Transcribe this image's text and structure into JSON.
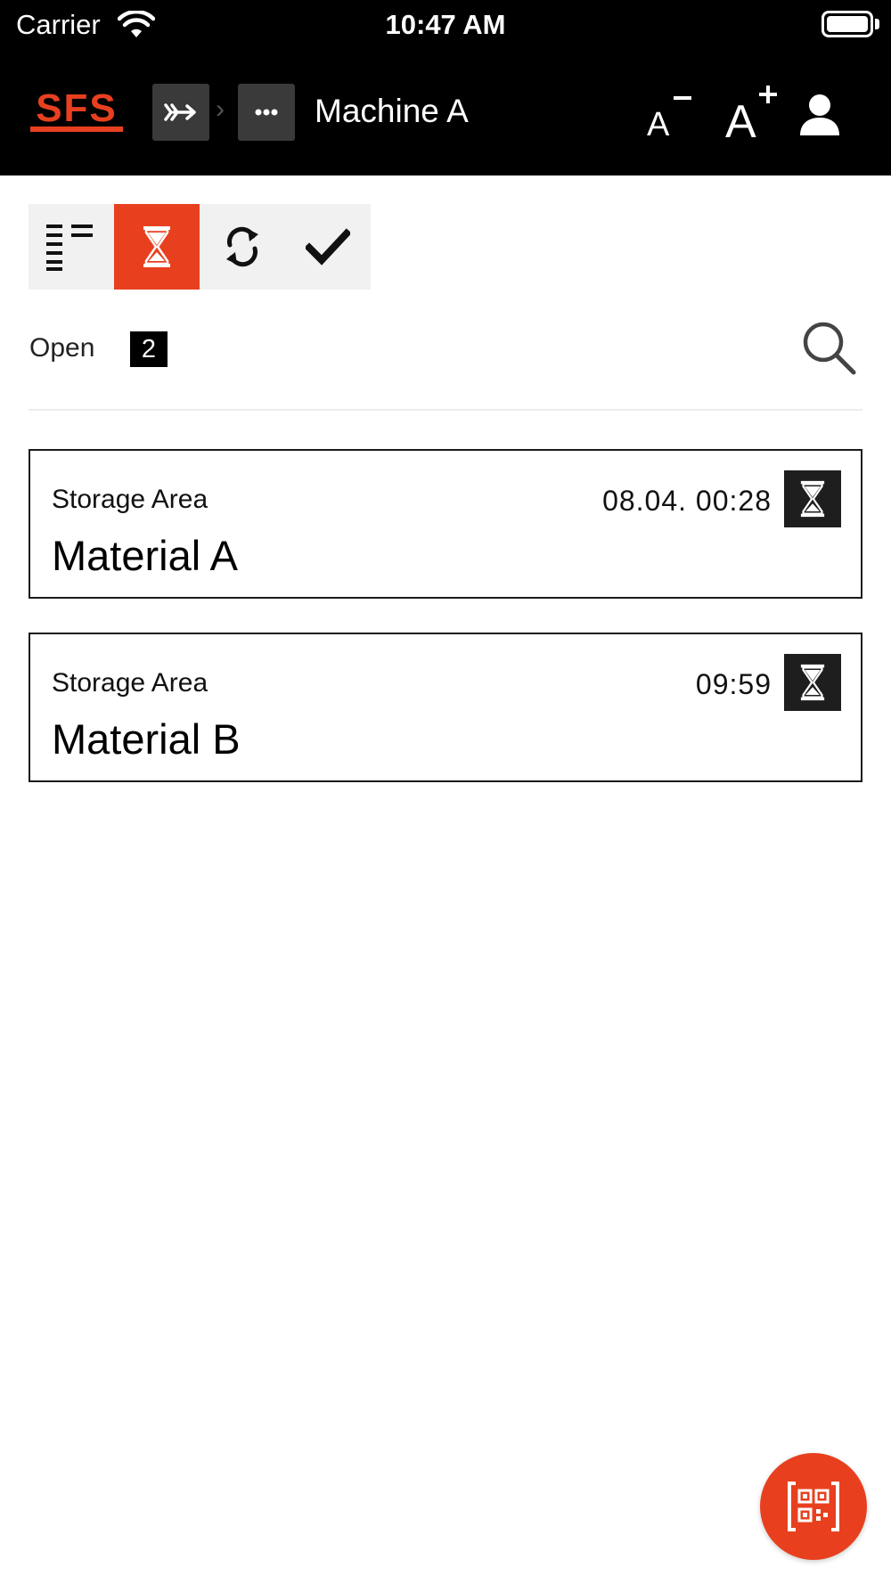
{
  "status_bar": {
    "carrier": "Carrier",
    "time": "10:47 AM"
  },
  "header": {
    "logo_text": "SFS",
    "title": "Machine A",
    "breadcrumb": [
      {
        "icon": "double-arrow-icon"
      },
      {
        "icon": "more-horizontal-icon"
      }
    ],
    "font_decrease_label": "A",
    "font_increase_label": "A"
  },
  "filters": {
    "selected": "pending",
    "items": [
      {
        "id": "all",
        "icon": "list-icon"
      },
      {
        "id": "pending",
        "icon": "hourglass-icon"
      },
      {
        "id": "in-progress",
        "icon": "refresh-icon"
      },
      {
        "id": "done",
        "icon": "checkmark-icon"
      }
    ]
  },
  "summary": {
    "label": "Open",
    "count": "2"
  },
  "items": [
    {
      "area": "Storage Area",
      "title": "Material A",
      "time": "08.04. 00:28",
      "status_icon": "hourglass-icon"
    },
    {
      "area": "Storage Area",
      "title": "Material B",
      "time": "09:59",
      "status_icon": "hourglass-icon"
    }
  ],
  "colors": {
    "accent": "#e8401f",
    "header_bg": "#000000",
    "card_border": "#1a1a1a"
  }
}
